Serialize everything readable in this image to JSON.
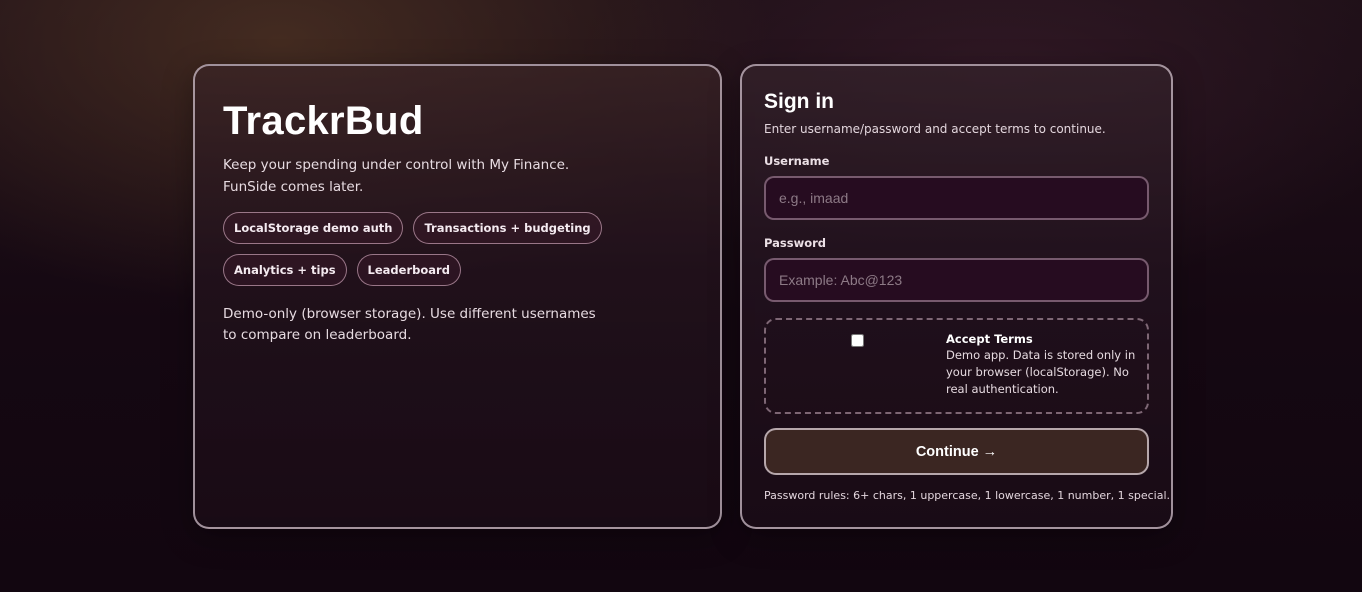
{
  "brand": {
    "name": "TrackrBud",
    "tagline_line1": "Keep your spending under control with My Finance.",
    "tagline_line2": "FunSide comes later."
  },
  "features": [
    "LocalStorage demo auth",
    "Transactions + budgeting",
    "Analytics + tips",
    "Leaderboard"
  ],
  "demo_note": "Demo-only (browser storage). Use different usernames to compare on leaderboard.",
  "signin": {
    "title": "Sign in",
    "subtitle": "Enter username/password and accept terms to continue.",
    "username_label": "Username",
    "username_placeholder": "e.g., imaad",
    "password_label": "Password",
    "password_placeholder": "Example: Abc@123",
    "terms_title": "Accept Terms",
    "terms_text": "Demo app. Data is stored only in your browser (localStorage). No real authentication.",
    "terms_checked": false,
    "continue_label": "Continue →",
    "password_rules": "Password rules: 6+ chars, 1 uppercase, 1 lowercase, 1 number, 1 special."
  },
  "colors": {
    "background": "#150812",
    "input_background": "#260c20",
    "button_background": "#3b2622",
    "card_border": "#cdbec8"
  }
}
